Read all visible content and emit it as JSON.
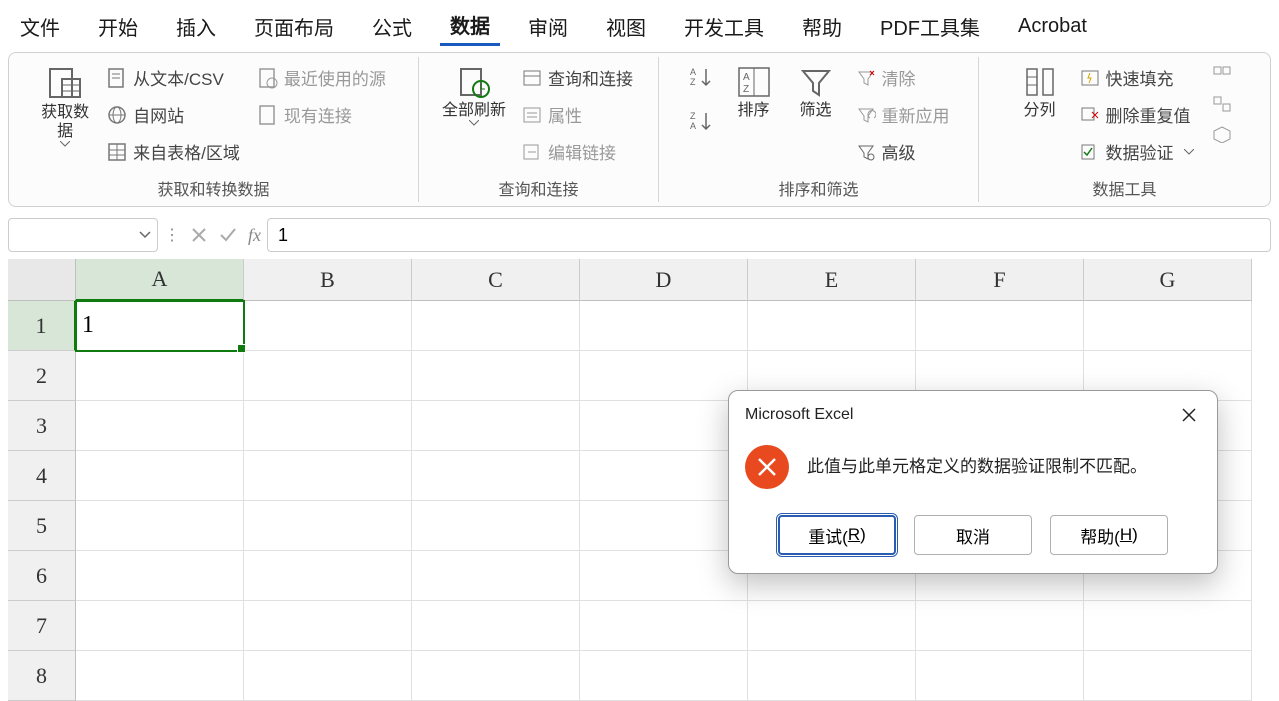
{
  "menu": {
    "tabs": [
      "文件",
      "开始",
      "插入",
      "页面布局",
      "公式",
      "数据",
      "审阅",
      "视图",
      "开发工具",
      "帮助",
      "PDF工具集",
      "Acrobat"
    ],
    "active_index": 5
  },
  "ribbon": {
    "group1": {
      "label": "获取和转换数据",
      "get_data": "获取数\n据",
      "from_text": "从文本/CSV",
      "from_web": "自网站",
      "from_table": "来自表格/区域",
      "recent": "最近使用的源",
      "existing": "现有连接"
    },
    "group2": {
      "label": "查询和连接",
      "refresh_all": "全部刷新",
      "queries": "查询和连接",
      "properties": "属性",
      "edit_links": "编辑链接"
    },
    "group3": {
      "label": "排序和筛选",
      "sort": "排序",
      "filter": "筛选",
      "clear": "清除",
      "reapply": "重新应用",
      "advanced": "高级"
    },
    "group4": {
      "label": "数据工具",
      "text_to_cols": "分列",
      "flash_fill": "快速填充",
      "remove_dup": "删除重复值",
      "data_validation": "数据验证"
    }
  },
  "formula_bar": {
    "name_box": "",
    "fx": "fx",
    "value": "1"
  },
  "grid": {
    "columns": [
      "A",
      "B",
      "C",
      "D",
      "E",
      "F",
      "G"
    ],
    "rows": [
      "1",
      "2",
      "3",
      "4",
      "5",
      "6",
      "7",
      "8"
    ],
    "active_cell": "A1",
    "cell_A1": "1"
  },
  "dialog": {
    "title": "Microsoft Excel",
    "message": "此值与此单元格定义的数据验证限制不匹配。",
    "retry": "重试(R)",
    "retry_prefix": "重试(",
    "retry_key": "R",
    "retry_suffix": ")",
    "cancel": "取消",
    "help": "帮助(H)",
    "help_prefix": "帮助(",
    "help_key": "H",
    "help_suffix": ")"
  }
}
